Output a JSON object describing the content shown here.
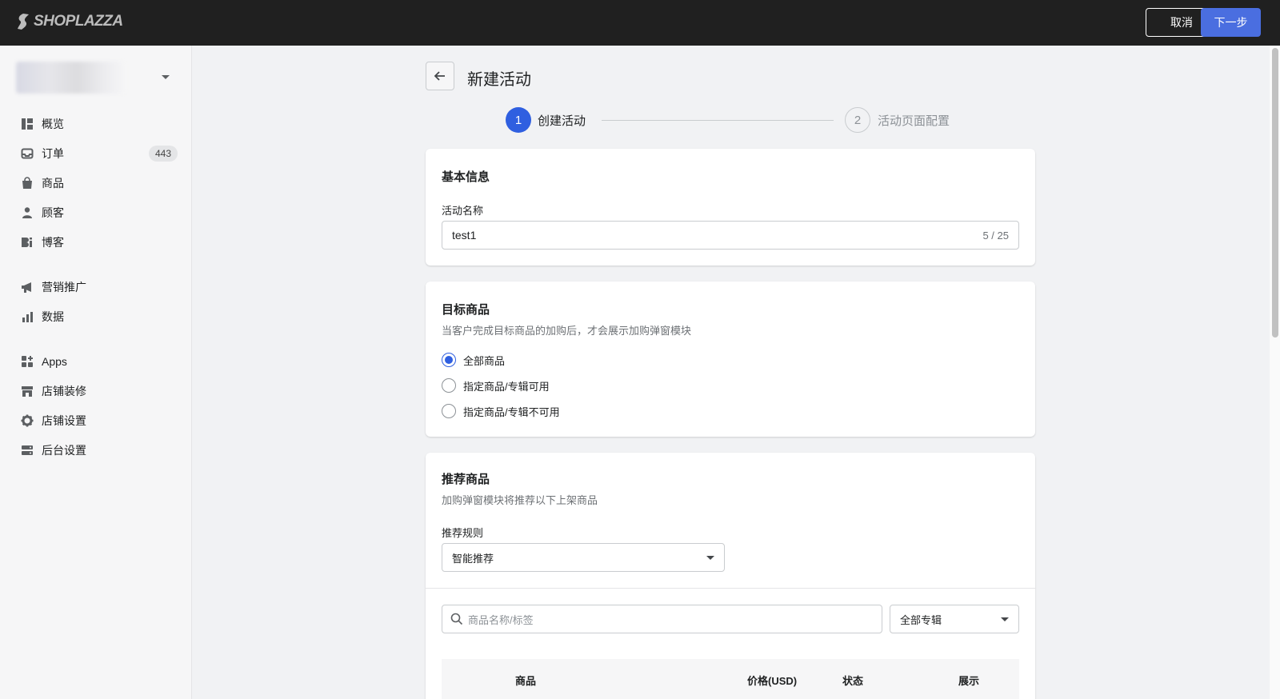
{
  "topbar": {
    "brand": "SHOPLAZZA",
    "cancel_label": "取消",
    "next_label": "下一步"
  },
  "sidebar": {
    "items": [
      {
        "label": "概览",
        "icon": "overview-icon"
      },
      {
        "label": "订单",
        "icon": "inbox-icon",
        "badge": "443"
      },
      {
        "label": "商品",
        "icon": "bag-icon"
      },
      {
        "label": "顾客",
        "icon": "person-icon"
      },
      {
        "label": "博客",
        "icon": "blog-icon"
      },
      {
        "label": "营销推广",
        "icon": "megaphone-icon"
      },
      {
        "label": "数据",
        "icon": "bar-chart-icon"
      },
      {
        "label": "Apps",
        "icon": "apps-icon"
      },
      {
        "label": "店铺装修",
        "icon": "store-icon"
      },
      {
        "label": "店铺设置",
        "icon": "gear-icon"
      },
      {
        "label": "后台设置",
        "icon": "server-icon"
      }
    ]
  },
  "header": {
    "title": "新建活动"
  },
  "steps": [
    {
      "number": "1",
      "label": "创建活动",
      "active": true
    },
    {
      "number": "2",
      "label": "活动页面配置",
      "active": false
    }
  ],
  "basic_info": {
    "title": "基本信息",
    "name_label": "活动名称",
    "name_value": "test1",
    "counter": "5 / 25"
  },
  "target_products": {
    "title": "目标商品",
    "subtitle": "当客户完成目标商品的加购后，才会展示加购弹窗模块",
    "options": [
      {
        "label": "全部商品",
        "checked": true
      },
      {
        "label": "指定商品/专辑可用",
        "checked": false
      },
      {
        "label": "指定商品/专辑不可用",
        "checked": false
      }
    ]
  },
  "recommended": {
    "title": "推荐商品",
    "subtitle": "加购弹窗模块将推荐以下上架商品",
    "rule_label": "推荐规则",
    "rule_value": "智能推荐",
    "search_placeholder": "商品名称/标签",
    "collection_value": "全部专辑",
    "columns": [
      "商品",
      "价格(USD)",
      "状态",
      "展示"
    ]
  }
}
